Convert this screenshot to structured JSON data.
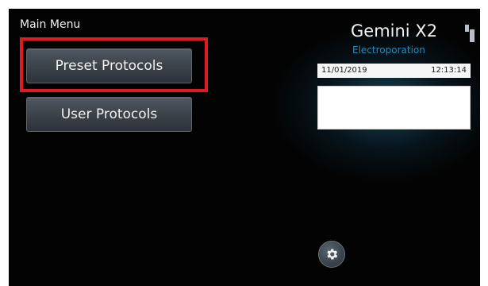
{
  "main_menu": {
    "title": "Main Menu",
    "buttons": [
      {
        "label": "Preset Protocols"
      },
      {
        "label": "User Protocols"
      }
    ]
  },
  "brand": {
    "name": "Gemini X2",
    "subtitle": "Electroporation",
    "subtitle_color": "#1f8fc0"
  },
  "status": {
    "date": "11/01/2019",
    "time": "12:13:14"
  },
  "highlight_color": "#e01a22",
  "icons": {
    "logo": "device-logo-icon",
    "settings": "gear-icon"
  }
}
